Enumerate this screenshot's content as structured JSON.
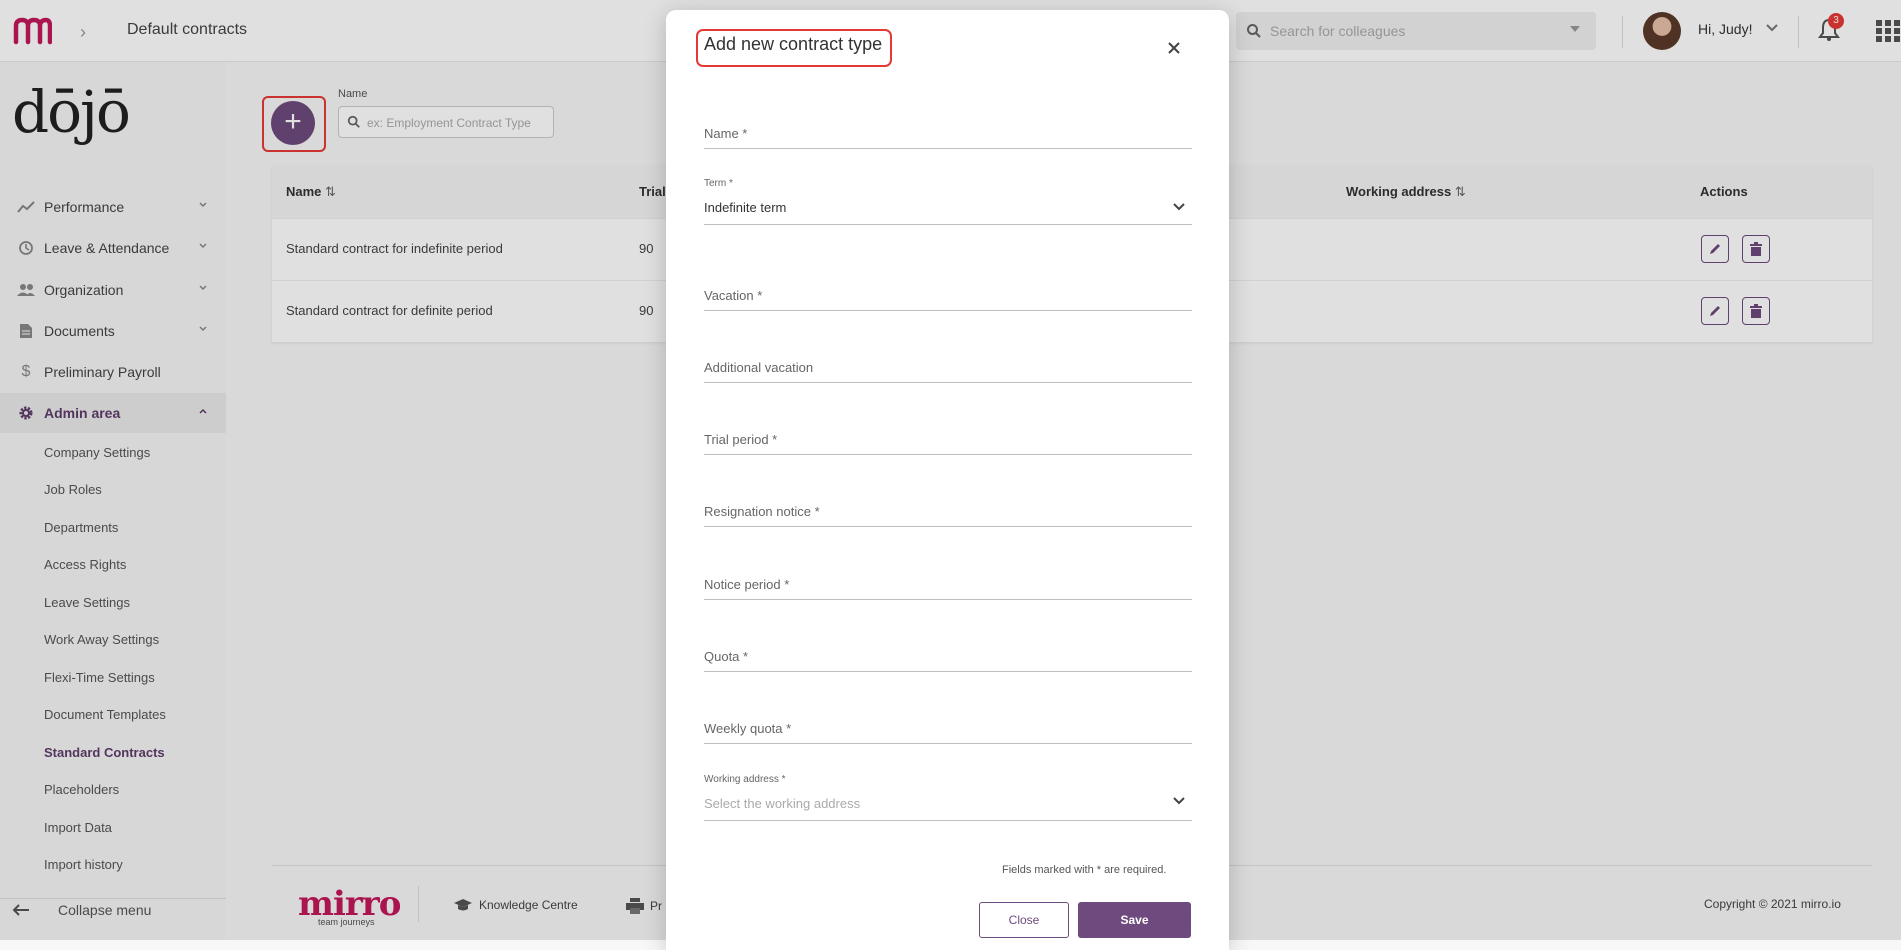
{
  "header": {
    "breadcrumb_title": "Default contracts",
    "search_placeholder": "Search for colleagues",
    "greeting": "Hi, Judy!",
    "notification_count": "3"
  },
  "sidebar": {
    "brand": "dōjō",
    "items": [
      {
        "label": "Performance",
        "icon": "trend-icon"
      },
      {
        "label": "Leave & Attendance",
        "icon": "history-icon"
      },
      {
        "label": "Organization",
        "icon": "people-icon"
      },
      {
        "label": "Documents",
        "icon": "document-icon"
      },
      {
        "label": "Preliminary Payroll",
        "icon": "dollar-icon"
      },
      {
        "label": "Admin area",
        "icon": "gear-icon"
      }
    ],
    "sub_items": [
      "Company Settings",
      "Job Roles",
      "Departments",
      "Access Rights",
      "Leave Settings",
      "Work Away Settings",
      "Flexi-Time Settings",
      "Document Templates",
      "Standard Contracts",
      "Placeholders",
      "Import Data",
      "Import history"
    ],
    "collapse_label": "Collapse menu"
  },
  "filter": {
    "label": "Name",
    "placeholder": "ex: Employment Contract Type"
  },
  "table": {
    "headers": {
      "name": "Name",
      "trial": "Trial",
      "working_address": "Working address",
      "actions": "Actions"
    },
    "rows": [
      {
        "name": "Standard contract for indefinite period",
        "trial": "90"
      },
      {
        "name": "Standard contract for definite period",
        "trial": "90"
      }
    ]
  },
  "footer": {
    "brand": "mirro",
    "tagline": "team journeys",
    "knowledge": "Knowledge Centre",
    "print_partial": "Pr",
    "copyright": "Copyright © 2021 mirro.io"
  },
  "modal": {
    "title": "Add new contract type",
    "fields": {
      "name": "Name *",
      "term_label": "Term *",
      "term_value": "Indefinite term",
      "vacation": "Vacation *",
      "additional_vacation": "Additional vacation",
      "trial_period": "Trial period *",
      "resignation_notice": "Resignation notice *",
      "notice_period": "Notice period *",
      "quota": "Quota *",
      "weekly_quota": "Weekly quota *",
      "working_address_label": "Working address *",
      "working_address_placeholder": "Select the working address"
    },
    "required_note": "Fields marked with * are required.",
    "close_label": "Close",
    "save_label": "Save"
  },
  "colors": {
    "accent": "#6e4a7e",
    "brand": "#c2185b",
    "highlight": "#e53935"
  }
}
